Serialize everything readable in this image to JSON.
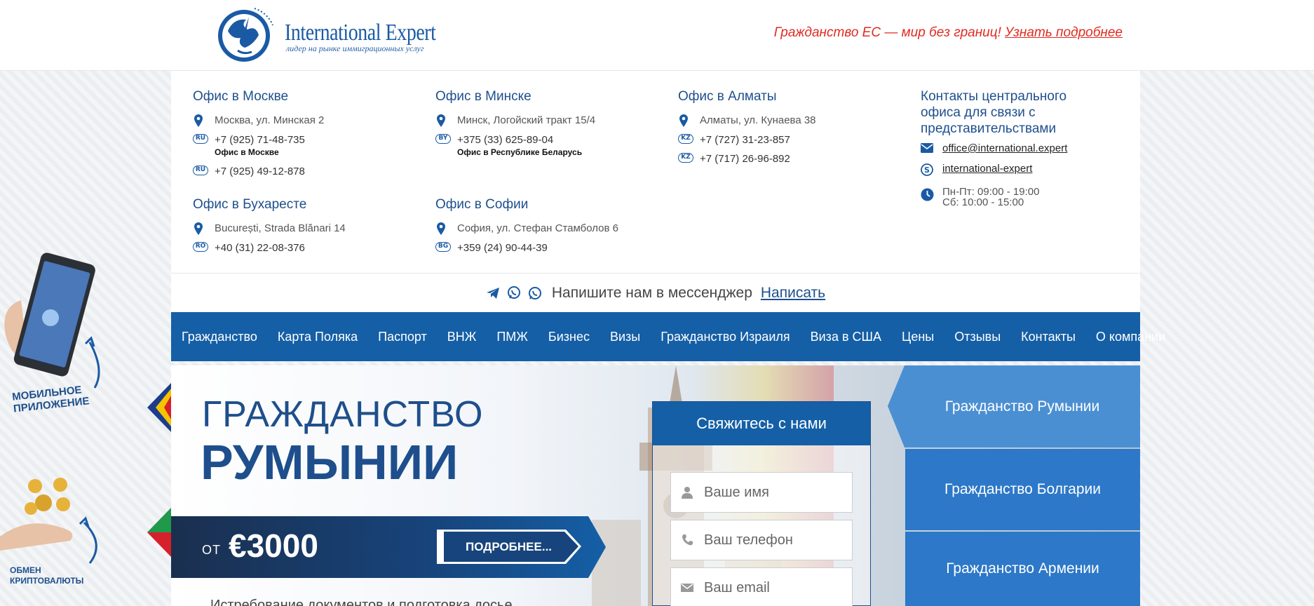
{
  "header": {
    "logo_title": "International Expert",
    "logo_subtitle": "лидер на рынке иммиграционных услуг",
    "promo_text": "Гражданство ЕС — мир без границ!",
    "promo_link": "Узнать подробнее"
  },
  "offices": [
    {
      "title": "Офис в Москве",
      "address": "Москва, ул. Минская 2",
      "phones": [
        {
          "cc": "RU",
          "number": "+7 (925) 71-48-735",
          "label": "Офис в Москве"
        },
        {
          "cc": "RU",
          "number": "+7 (925) 49-12-878",
          "label": ""
        }
      ]
    },
    {
      "title": "Офис в Минске",
      "address": "Минск, Логойский тракт 15/4",
      "phones": [
        {
          "cc": "BY",
          "number": "+375 (33) 625-89-04",
          "label": "Офис в Республике Беларусь"
        }
      ]
    },
    {
      "title": "Офис в Алматы",
      "address": "Алматы, ул. Кунаева 38",
      "phones": [
        {
          "cc": "KZ",
          "number": "+7 (727) 31-23-857",
          "label": ""
        },
        {
          "cc": "KZ",
          "number": "+7 (717) 26-96-892",
          "label": ""
        }
      ]
    },
    {
      "title": "Офис в Бухаресте",
      "address": "București, Strada Blănari 14",
      "phones": [
        {
          "cc": "RO",
          "number": "+40 (31) 22-08-376",
          "label": ""
        }
      ]
    },
    {
      "title": "Офис в Софии",
      "address": "София, ул. Стефан Стамболов 6",
      "phones": [
        {
          "cc": "BG",
          "number": "+359 (24) 90-44-39",
          "label": ""
        }
      ]
    }
  ],
  "central": {
    "title": "Контакты центрального офиса для связи с представительствами",
    "email": "office@international.expert",
    "skype": "international-expert",
    "hours_weekday": "Пн-Пт: 09:00 - 19:00",
    "hours_saturday": "Сб: 10:00 - 15:00"
  },
  "messenger": {
    "text": "Напишите нам в мессенджер",
    "link": "Написать"
  },
  "nav": [
    "Гражданство",
    "Карта Поляка",
    "Паспорт",
    "ВНЖ",
    "ПМЖ",
    "Бизнес",
    "Визы",
    "Гражданство Израиля",
    "Виза в США",
    "Цены",
    "Отзывы",
    "Контакты",
    "О компании"
  ],
  "hero": {
    "title_line1": "ГРАЖДАНСТВО",
    "title_line2": "РУМЫНИИ",
    "price_from": "ОТ",
    "price_value": "€3000",
    "more_button": "ПОДРОБНЕЕ...",
    "description": "Истребование документов и подготовка досье"
  },
  "form": {
    "title": "Свяжитесь с нами",
    "name_placeholder": "Ваше имя",
    "phone_placeholder": "Ваш телефон",
    "email_placeholder": "Ваш email"
  },
  "right_tabs": [
    "Гражданство Румынии",
    "Гражданство Болгарии",
    "Гражданство Армении"
  ],
  "side": {
    "app_label_1": "МОБИЛЬНОЕ",
    "app_label_2": "ПРИЛОЖЕНИЕ",
    "crypto_label_1": "ОБМЕН",
    "crypto_label_2": "КРИПТОВАЛЮТЫ"
  },
  "colors": {
    "brand_blue": "#155fa6",
    "dark_blue": "#1e4f8c",
    "promo_red": "#e02b20",
    "tab_active": "#4b8fd3"
  }
}
